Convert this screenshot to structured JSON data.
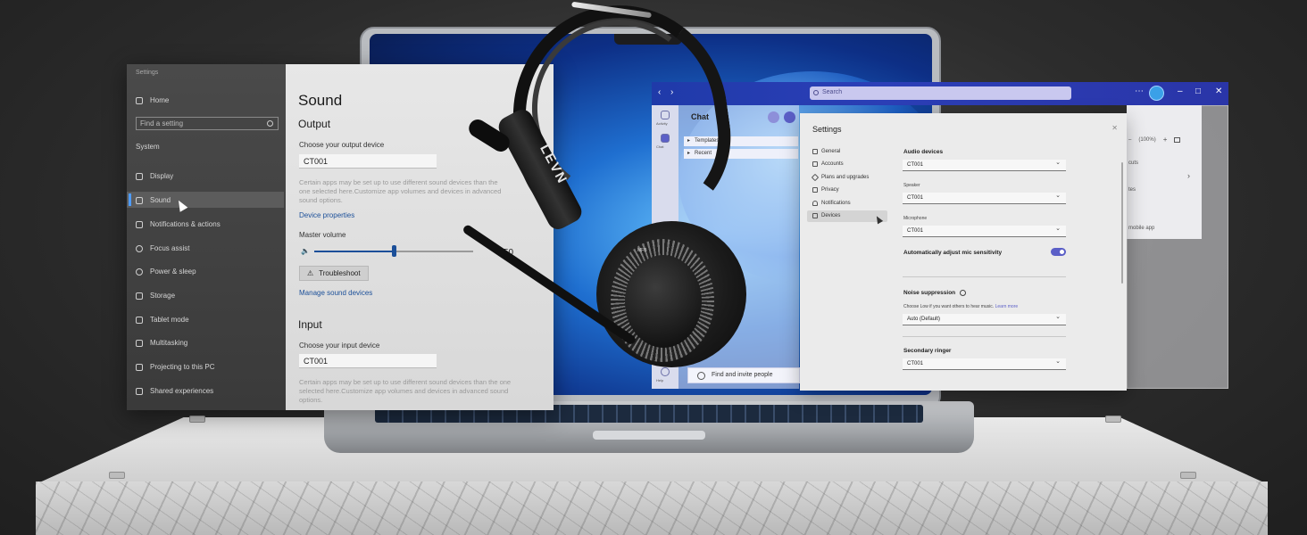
{
  "windows_settings": {
    "app_title": "Settings",
    "home": "Home",
    "search_placeholder": "Find a setting",
    "section": "System",
    "nav": [
      {
        "label": "Display",
        "icon": "monitor-icon"
      },
      {
        "label": "Sound",
        "icon": "speaker-icon",
        "selected": true
      },
      {
        "label": "Notifications & actions",
        "icon": "notification-icon"
      },
      {
        "label": "Focus assist",
        "icon": "moon-icon"
      },
      {
        "label": "Power & sleep",
        "icon": "power-icon"
      },
      {
        "label": "Storage",
        "icon": "storage-icon"
      },
      {
        "label": "Tablet mode",
        "icon": "tablet-icon"
      },
      {
        "label": "Multitasking",
        "icon": "multitasking-icon"
      },
      {
        "label": "Projecting to this PC",
        "icon": "projector-icon"
      },
      {
        "label": "Shared experiences",
        "icon": "shared-icon"
      }
    ],
    "page_title": "Sound",
    "output": {
      "heading": "Output",
      "choose_label": "Choose your output device",
      "device": "CT001",
      "note": "Certain apps may be set up to use different sound devices than the one selected here.Customize app volumes and devices in advanced sound options.",
      "device_properties": "Device properties",
      "master_volume_label": "Master volume",
      "volume": 50,
      "troubleshoot": "Troubleshoot",
      "manage": "Manage sound devices"
    },
    "input": {
      "heading": "Input",
      "choose_label": "Choose your input device",
      "device": "CT001",
      "note": "Certain apps may be set up to use different sound devices than the one selected here.Customize app volumes and devices in advanced sound options."
    }
  },
  "teams": {
    "search_placeholder": "Search",
    "chat_title": "Chat",
    "rail": [
      "Activity",
      "Chat",
      "Help"
    ],
    "chat_rows": [
      "Templates",
      "Recent"
    ],
    "find_invite": "Find and invite people",
    "zoom": "(100%)",
    "right_items": [
      "cuts",
      "tes",
      "mobile app"
    ],
    "settings_dialog": {
      "title": "Settings",
      "nav": [
        {
          "label": "General",
          "icon": "general-icon"
        },
        {
          "label": "Accounts",
          "icon": "accounts-icon"
        },
        {
          "label": "Plans and upgrades",
          "icon": "diamond-icon"
        },
        {
          "label": "Privacy",
          "icon": "lock-icon"
        },
        {
          "label": "Notifications",
          "icon": "bell-icon"
        },
        {
          "label": "Devices",
          "icon": "devices-icon",
          "selected": true
        }
      ],
      "audio_devices_heading": "Audio devices",
      "audio_devices_value": "CT001",
      "speaker_label": "Speaker",
      "speaker_value": "CT001",
      "microphone_label": "Microphone",
      "microphone_value": "CT001",
      "auto_adjust_label": "Automatically adjust mic sensitivity",
      "auto_adjust_on": true,
      "noise_heading": "Noise suppression",
      "noise_hint": "Choose Low if you want others to hear music.",
      "learn_more": "Learn more",
      "noise_value": "Auto (Default)",
      "secondary_ringer_heading": "Secondary ringer",
      "secondary_ringer_value": "CT001"
    }
  },
  "headset": {
    "brand": "LEVN",
    "button_label": "MFB"
  },
  "colors": {
    "accent_windows": "#1b4f99",
    "teams_bar": "#2c3fb8",
    "teams_toggle": "#5b5fc7"
  }
}
